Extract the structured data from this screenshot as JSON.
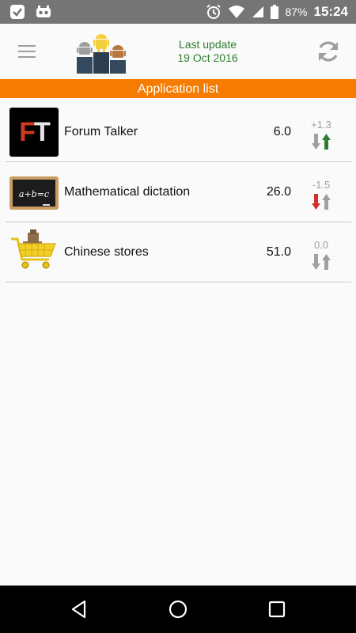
{
  "status_bar": {
    "battery_percent": "87%",
    "time": "15:24"
  },
  "header": {
    "last_update_label": "Last update",
    "last_update_date": "19 Oct 2016"
  },
  "section": {
    "title": "Application list"
  },
  "apps": [
    {
      "name": "Forum Talker",
      "score": "6.0",
      "delta": "+1.3",
      "trend": "up",
      "icon": "forum-talker-icon",
      "icon_text": "FT"
    },
    {
      "name": "Mathematical dictation",
      "score": "26.0",
      "delta": "-1.5",
      "trend": "down",
      "icon": "chalkboard-icon",
      "icon_text": "a+b=c"
    },
    {
      "name": "Chinese stores",
      "score": "51.0",
      "delta": "0.0",
      "trend": "neutral",
      "icon": "shopping-cart-icon"
    }
  ],
  "colors": {
    "accent_orange": "#f57c00",
    "update_green": "#2e7d32",
    "trend_up": "#2e7d32",
    "trend_down": "#d32f2f",
    "trend_neutral": "#a0a0a0"
  }
}
